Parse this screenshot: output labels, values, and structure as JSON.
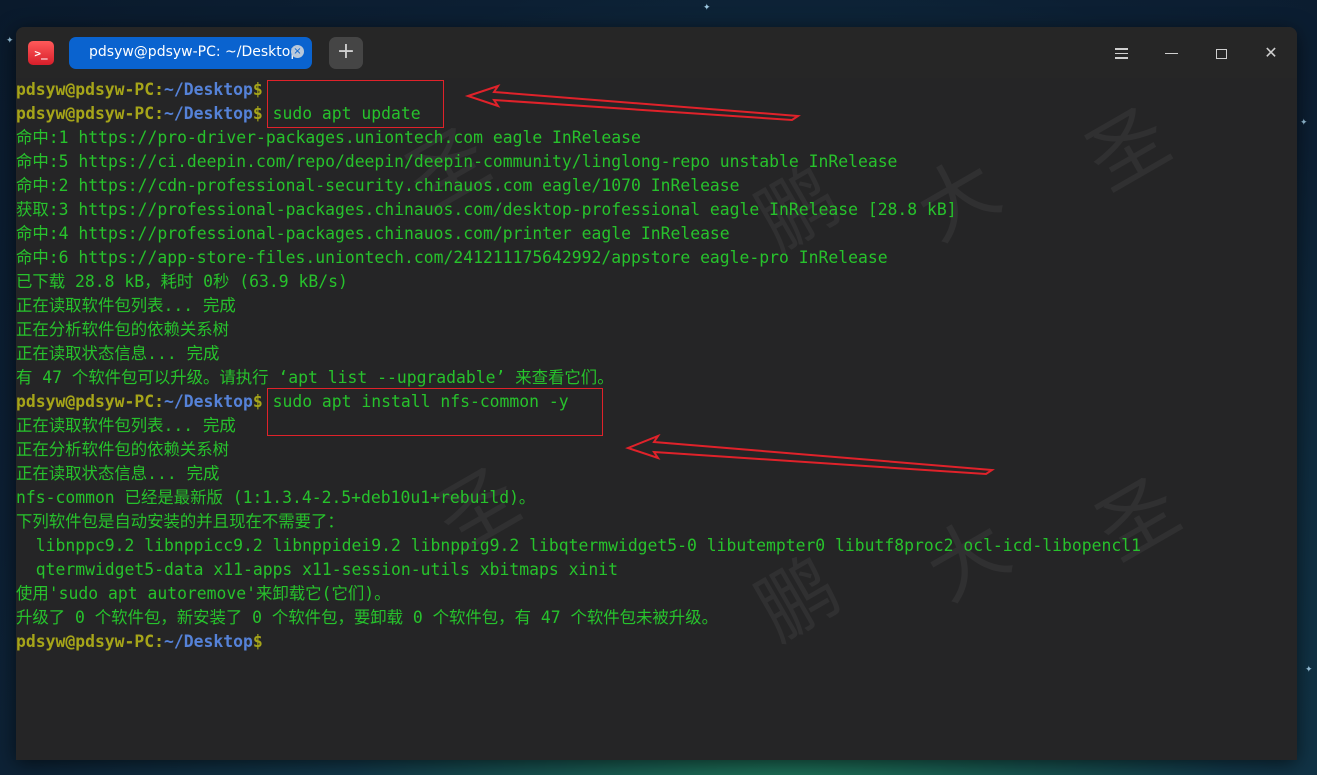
{
  "window": {
    "tab_title": "pdsyw@pdsyw-PC: ~/Desktop",
    "tab_close": "×",
    "new_tab": "+",
    "icons": {
      "app": "terminal-app-icon",
      "menu": "hamburger-menu-icon",
      "minimize": "minimize-icon",
      "maximize": "maximize-icon",
      "close": "close-icon"
    }
  },
  "prompt": {
    "user": "pdsyw@pdsyw-PC",
    "colon": ":",
    "path": "~/Desktop",
    "dollar": "$"
  },
  "commands": {
    "update": " sudo apt update",
    "install": " sudo apt install nfs-common -y"
  },
  "output": {
    "update": [
      "命中:1 https://pro-driver-packages.uniontech.com eagle InRelease",
      "命中:5 https://ci.deepin.com/repo/deepin/deepin-community/linglong-repo unstable InRelease",
      "命中:2 https://cdn-professional-security.chinauos.com eagle/1070 InRelease",
      "获取:3 https://professional-packages.chinauos.com/desktop-professional eagle InRelease [28.8 kB]",
      "命中:4 https://professional-packages.chinauos.com/printer eagle InRelease",
      "命中:6 https://app-store-files.uniontech.com/241211175642992/appstore eagle-pro InRelease",
      "已下载 28.8 kB，耗时 0秒 (63.9 kB/s)",
      "正在读取软件包列表... 完成",
      "正在分析软件包的依赖关系树",
      "正在读取状态信息... 完成",
      "有 47 个软件包可以升级。请执行 ‘apt list --upgradable’ 来查看它们。"
    ],
    "install": [
      "正在读取软件包列表... 完成",
      "正在分析软件包的依赖关系树",
      "正在读取状态信息... 完成",
      "nfs-common 已经是最新版 (1:1.3.4-2.5+deb10u1+rebuild)。",
      "下列软件包是自动安装的并且现在不需要了：",
      "  libnppc9.2 libnppicc9.2 libnppidei9.2 libnppig9.2 libqtermwidget5-0 libutempter0 libutf8proc2 ocl-icd-libopencl1",
      "  qtermwidget5-data x11-apps x11-session-utils xbitmaps xinit",
      "使用'sudo apt autoremove'来卸载它(它们)。",
      "升级了 0 个软件包，新安装了 0 个软件包，要卸载 0 个软件包，有 47 个软件包未被升级。"
    ]
  },
  "watermark": [
    "鹏",
    "大",
    "圣"
  ],
  "colors": {
    "output_green": "#27c22c",
    "prompt_user": "#a6a519",
    "prompt_path": "#5582d8",
    "annotation_red": "#e0222a",
    "tab_blue": "#0a63cf"
  }
}
